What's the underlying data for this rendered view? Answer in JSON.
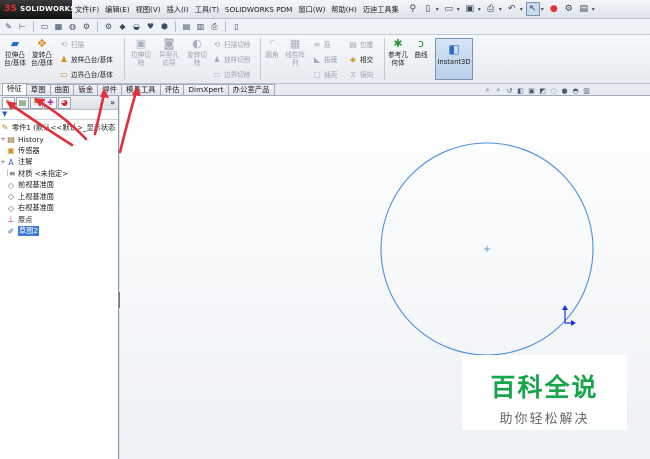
{
  "app": {
    "logo_prefix": "3S",
    "logo_text": "SOLIDWORKS"
  },
  "menu": [
    "文件(F)",
    "编辑(E)",
    "视图(V)",
    "插入(I)",
    "工具(T)",
    "SOLIDWORKS PDM",
    "窗口(W)",
    "帮助(H)",
    "迈迪工具集"
  ],
  "ribbon": {
    "extrude_boss": "拉伸凸台/基体",
    "revolve_boss": "旋转凸台/基体",
    "sweep": "扫描",
    "loft_boss": "放样凸台/基体",
    "boundary_boss": "边界凸台/基体",
    "extrude_cut": "拉伸切除",
    "hole_wizard": "异型孔向导",
    "revolve_cut": "旋转切除",
    "swept_cut": "扫描切除",
    "lofted_cut": "放样切割",
    "boundary_cut": "边界切除",
    "fillet": "圆角",
    "linear_pattern": "线性阵列",
    "rib": "筋",
    "draft": "拔模",
    "shell": "抽壳",
    "wrap": "包覆",
    "intersect": "相交",
    "mirror": "镜向",
    "ref_geometry": "参考几何体",
    "curves": "曲线",
    "instant3d": "Instant3D"
  },
  "tabs": [
    "特征",
    "草图",
    "曲面",
    "钣金",
    "焊件",
    "模具工具",
    "评估",
    "DimXpert",
    "办公室产品"
  ],
  "active_tab": 0,
  "tree": {
    "root": "零件1 (默认<<默认>_显示状态",
    "items": [
      {
        "label": "History",
        "icon": "history-icon",
        "expand": "+"
      },
      {
        "label": "传感器",
        "icon": "sensor-icon",
        "expand": ""
      },
      {
        "label": "注解",
        "icon": "annotation-icon",
        "expand": "+"
      },
      {
        "label": "材质 <未指定>",
        "icon": "material-icon",
        "expand": ""
      },
      {
        "label": "前视基准面",
        "icon": "plane-icon",
        "expand": ""
      },
      {
        "label": "上视基准面",
        "icon": "plane-icon",
        "expand": ""
      },
      {
        "label": "右视基准面",
        "icon": "plane-icon",
        "expand": ""
      },
      {
        "label": "原点",
        "icon": "origin-icon",
        "expand": ""
      },
      {
        "label": "草图2",
        "icon": "sketch-icon",
        "expand": ""
      }
    ],
    "selected": 8
  },
  "watermark": {
    "title": "百科全说",
    "subtitle": "助你轻松解决"
  },
  "colors": {
    "sketch_circle": "#4a90e2",
    "origin": "#1c2fd6",
    "annotation_arrow": "#e0303a",
    "watermark_green": "#17a54a",
    "selection": "#3d7bd4"
  }
}
